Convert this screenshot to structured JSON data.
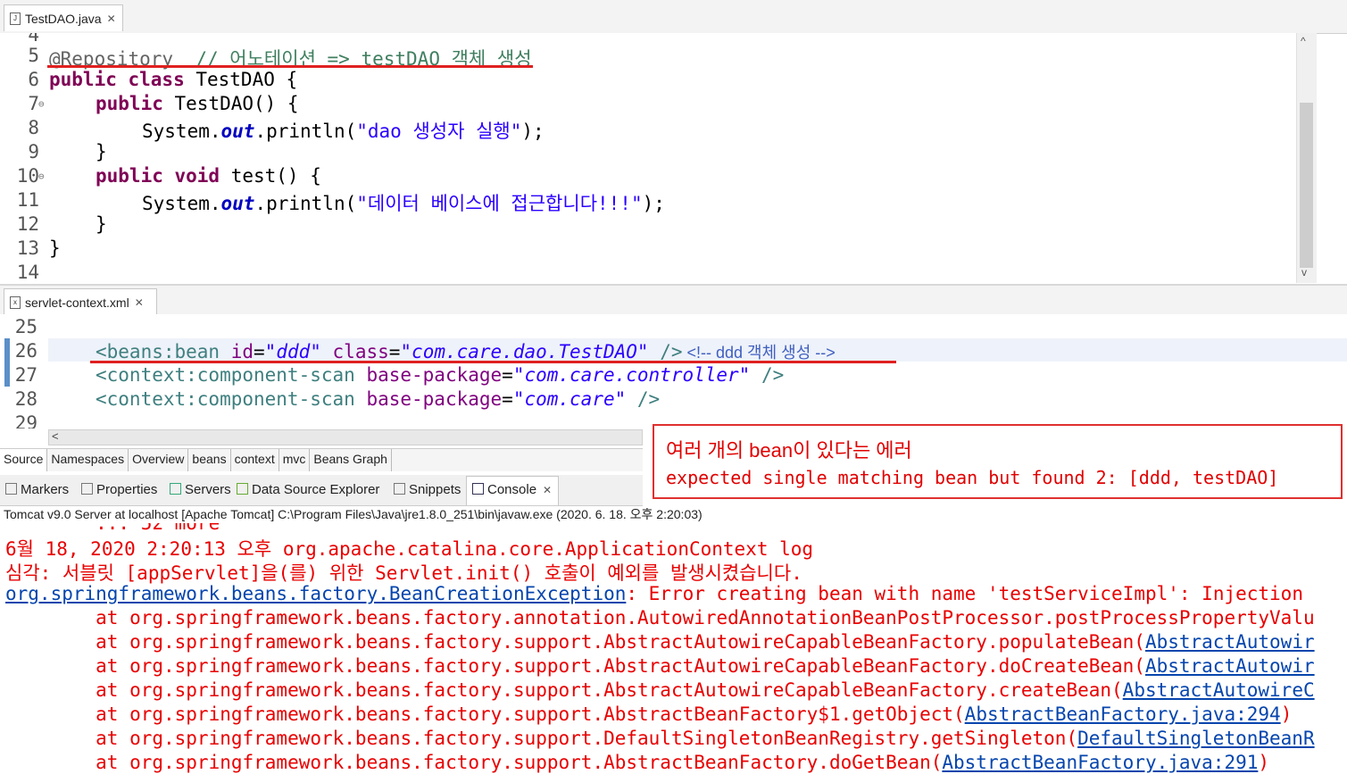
{
  "editor1": {
    "tab_label": "TestDAO.java",
    "close_glyph": "✕",
    "line_numbers": [
      "4",
      "5",
      "6",
      "7",
      "8",
      "9",
      "10",
      "11",
      "12",
      "13",
      "14"
    ],
    "lines": {
      "l5_annotation": "@Repository",
      "l5_comment": "  // 어노테이션 => testDAO 객체 생성",
      "l6_kw": "public class",
      "l6_rest": " TestDAO {",
      "l7_kw": "public",
      "l7_rest": " TestDAO() {",
      "l8_a": "System.",
      "l8_field": "out",
      "l8_b": ".println(",
      "l8_str": "\"dao 생성자 실행\"",
      "l8_c": ");",
      "l9": "}",
      "l10_kw": "public void",
      "l10_rest": " test() {",
      "l11_a": "System.",
      "l11_field": "out",
      "l11_b": ".println(",
      "l11_str": "\"데이터 베이스에 접근합니다!!!\"",
      "l11_c": ");",
      "l12": "}",
      "l13": "}"
    },
    "scroll_up": "^",
    "scroll_down": "v"
  },
  "editor2": {
    "tab_label": "servlet-context.xml",
    "close_glyph": "✕",
    "line_numbers": [
      "25",
      "26",
      "27",
      "28",
      "29"
    ],
    "l26": {
      "open": "<beans:bean ",
      "id_attr": "id",
      "eq1": "=",
      "id_val": "\"ddd\"",
      "class_attr": " class",
      "eq2": "=",
      "class_val": "\"com.care.dao.TestDAO\"",
      "close": " />",
      "comment": " <!-- ddd 객체 생성 -->"
    },
    "l27": {
      "open": "<context:component-scan ",
      "attr": "base-package",
      "eq": "=",
      "val": "\"com.care.controller\"",
      "close": " />"
    },
    "l28": {
      "open": "<context:component-scan ",
      "attr": "base-package",
      "eq": "=",
      "val": "\"com.care\"",
      "close": " />"
    },
    "scroll_left": "<",
    "bottom_tabs": [
      "Source",
      "Namespaces",
      "Overview",
      "beans",
      "context",
      "mvc",
      "Beans Graph"
    ]
  },
  "views": {
    "tabs": [
      "Markers",
      "Properties",
      "Servers",
      "Data Source Explorer",
      "Snippets",
      "Console"
    ],
    "console_close": "✕",
    "console_header": "Tomcat v9.0 Server at localhost [Apache Tomcat] C:\\Program Files\\Java\\jre1.8.0_251\\bin\\javaw.exe  (2020. 6. 18. 오후 2:20:03)",
    "lines": {
      "partial": "        ... 52 more",
      "l1": "6월 18, 2020 2:20:13 오후 org.apache.catalina.core.ApplicationContext log",
      "l2": "심각: 서블릿 [appServlet]을(를) 위한 Servlet.init() 호출이 예외를 발생시켰습니다.",
      "l3_link": "org.springframework.beans.factory.BeanCreationException",
      "l3_rest": ": Error creating bean with name 'testServiceImpl': Injection",
      "at1": "        at org.springframework.beans.factory.annotation.AutowiredAnnotationBeanPostProcessor.postProcessPropertyValu",
      "at2_a": "        at org.springframework.beans.factory.support.AbstractAutowireCapableBeanFactory.populateBean(",
      "at2_link": "AbstractAutowir",
      "at3_a": "        at org.springframework.beans.factory.support.AbstractAutowireCapableBeanFactory.doCreateBean(",
      "at3_link": "AbstractAutowir",
      "at4_a": "        at org.springframework.beans.factory.support.AbstractAutowireCapableBeanFactory.createBean(",
      "at4_link": "AbstractAutowireC",
      "at5_a": "        at org.springframework.beans.factory.support.AbstractBeanFactory$1.getObject(",
      "at5_link": "AbstractBeanFactory.java:294",
      "at5_c": ")",
      "at6_a": "        at org.springframework.beans.factory.support.DefaultSingletonBeanRegistry.getSingleton(",
      "at6_link": "DefaultSingletonBeanR",
      "at7_a": "        at org.springframework.beans.factory.support.AbstractBeanFactory.doGetBean(",
      "at7_link": "AbstractBeanFactory.java:291",
      "at7_c": ")"
    }
  },
  "callout": {
    "title": "여러 개의 bean이 있다는 에러",
    "detail": "expected single matching bean but found 2: [ddd, testDAO]"
  },
  "colors": {
    "keyword": "#7f0055",
    "string": "#2a00ff",
    "comment": "#3f7f5f",
    "console_error": "#e80000",
    "highlight": "#e02020"
  }
}
